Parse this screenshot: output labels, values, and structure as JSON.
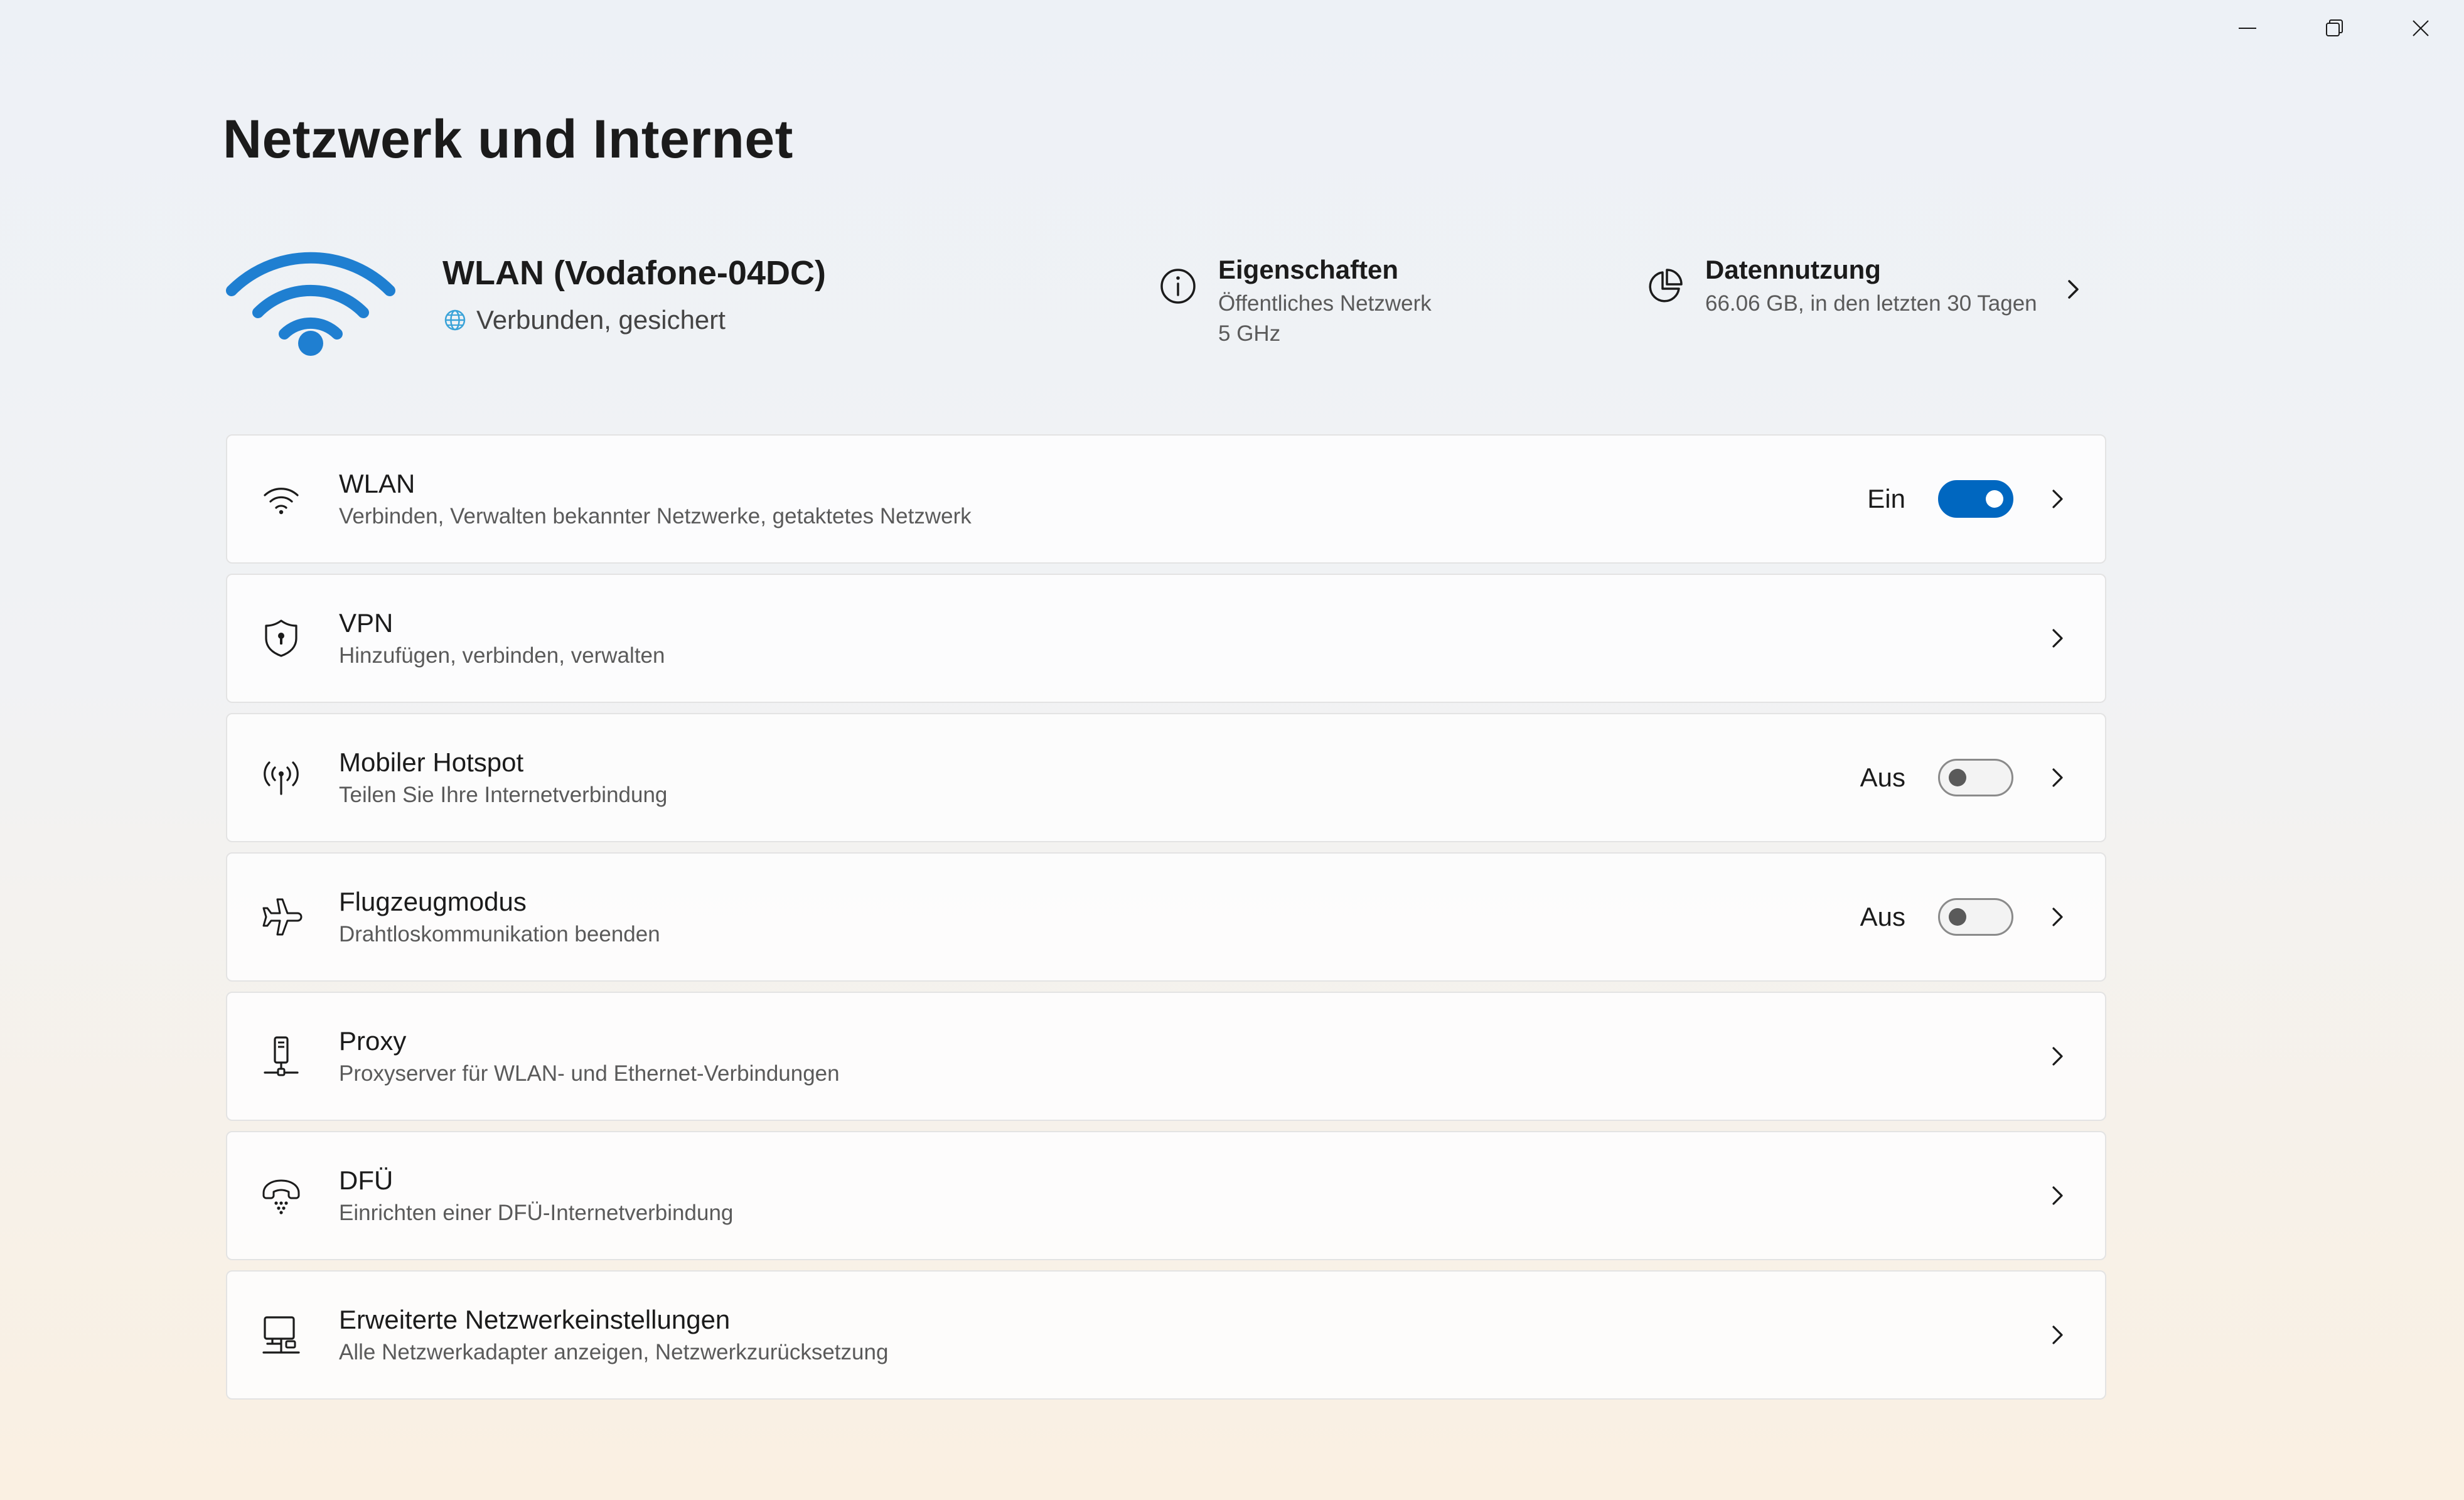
{
  "window": {
    "controls": {
      "minimize": "minimize-icon",
      "restore": "restore-icon",
      "close": "close-icon"
    }
  },
  "page": {
    "title": "Netzwerk und Internet"
  },
  "connection": {
    "name": "WLAN (Vodafone-04DC)",
    "status": "Verbunden, gesichert",
    "properties": {
      "title": "Eigenschaften",
      "network_type": "Öffentliches Netzwerk",
      "band": "5 GHz"
    },
    "data_usage": {
      "title": "Datennutzung",
      "summary": "66.06 GB, in den letzten 30 Tagen"
    }
  },
  "settings": [
    {
      "id": "wlan",
      "icon": "wifi-icon",
      "title": "WLAN",
      "description": "Verbinden, Verwalten bekannter Netzwerke, getaktetes Netzwerk",
      "state_label": "Ein",
      "toggle": true
    },
    {
      "id": "vpn",
      "icon": "shield-icon",
      "title": "VPN",
      "description": "Hinzufügen, verbinden, verwalten"
    },
    {
      "id": "hotspot",
      "icon": "hotspot-icon",
      "title": "Mobiler Hotspot",
      "description": "Teilen Sie Ihre Internetverbindung",
      "state_label": "Aus",
      "toggle": false
    },
    {
      "id": "airplane",
      "icon": "airplane-icon",
      "title": "Flugzeugmodus",
      "description": "Drahtloskommunikation beenden",
      "state_label": "Aus",
      "toggle": false
    },
    {
      "id": "proxy",
      "icon": "proxy-icon",
      "title": "Proxy",
      "description": "Proxyserver für WLAN- und Ethernet-Verbindungen"
    },
    {
      "id": "dialup",
      "icon": "dialup-icon",
      "title": "DFÜ",
      "description": "Einrichten einer DFÜ-Internetverbindung"
    },
    {
      "id": "advanced",
      "icon": "network-adapter-icon",
      "title": "Erweiterte Netzwerkeinstellungen",
      "description": "Alle Netzwerkadapter anzeigen, Netzwerkzurücksetzung"
    }
  ],
  "colors": {
    "accent": "#0067c0",
    "wifi_icon": "#1f7fd1",
    "globe": "#3aa3d8"
  }
}
